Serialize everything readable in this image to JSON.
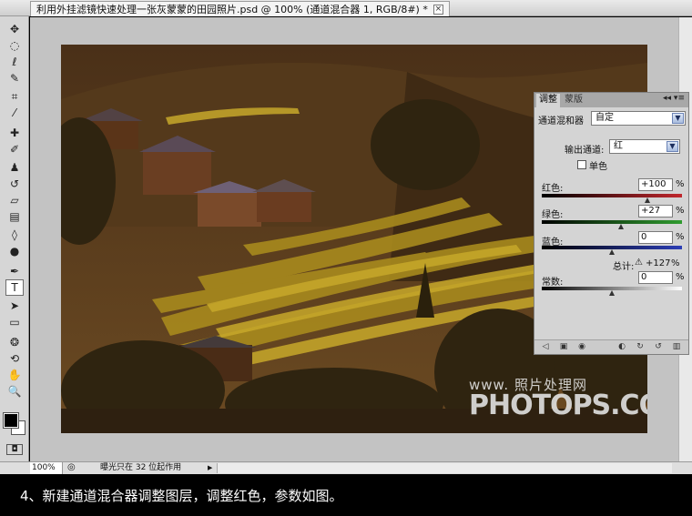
{
  "document": {
    "tab_title": "利用外挂滤镜快速处理一张灰蒙蒙的田园照片.psd @ 100% (通道混合器 1, RGB/8#) *",
    "close_glyph": "×"
  },
  "toolbox": {
    "tools": [
      {
        "name": "move-tool",
        "glyph": "✥"
      },
      {
        "name": "marquee-tool",
        "glyph": "◌"
      },
      {
        "name": "lasso-tool",
        "glyph": "ℓ"
      },
      {
        "name": "quick-select-tool",
        "glyph": "✎"
      },
      {
        "name": "crop-tool",
        "glyph": "⌗"
      },
      {
        "name": "eyedropper-tool",
        "glyph": "⁄"
      },
      {
        "name": "healing-tool",
        "glyph": "✚"
      },
      {
        "name": "brush-tool",
        "glyph": "✐"
      },
      {
        "name": "stamp-tool",
        "glyph": "♟"
      },
      {
        "name": "history-brush-tool",
        "glyph": "↺"
      },
      {
        "name": "eraser-tool",
        "glyph": "▱"
      },
      {
        "name": "gradient-tool",
        "glyph": "▤"
      },
      {
        "name": "blur-tool",
        "glyph": "◊"
      },
      {
        "name": "dodge-tool",
        "glyph": "●"
      },
      {
        "name": "pen-tool",
        "glyph": "✒"
      },
      {
        "name": "type-tool",
        "glyph": "T"
      },
      {
        "name": "path-select-tool",
        "glyph": "➤"
      },
      {
        "name": "shape-tool",
        "glyph": "▭"
      },
      {
        "name": "3d-rotate-tool",
        "glyph": "❂"
      },
      {
        "name": "3d-orbit-tool",
        "glyph": "⟲"
      },
      {
        "name": "hand-tool",
        "glyph": "✋"
      },
      {
        "name": "zoom-tool",
        "glyph": "🔍"
      }
    ]
  },
  "adjustments_panel": {
    "tab_adjust": "调整",
    "tab_mask": "蒙版",
    "menu_glyph": "◂◂ ▾≡",
    "title": "通道混和器",
    "preset_value": "自定",
    "output_channel_label": "输出通道:",
    "output_channel_value": "红",
    "monochrome_label": "单色",
    "red_label": "红色:",
    "red_value": "+100",
    "green_label": "绿色:",
    "green_value": "+27",
    "blue_label": "蓝色:",
    "blue_value": "0",
    "total_label": "总计:",
    "total_warning_glyph": "⚠",
    "total_value": "+127",
    "constant_label": "常数:",
    "constant_value": "0",
    "percent_sign": "%",
    "slider_levels": {
      "red": 100,
      "green": 27,
      "blue": 0,
      "constant": 0
    },
    "colors": {
      "red": "#c1272d",
      "green": "#2f9c2f",
      "blue": "#2c3eb5"
    }
  },
  "watermark": {
    "line1": "www.    照片处理网",
    "line2": "PHOTOPS.COM"
  },
  "statusbar": {
    "zoom": "100%",
    "info": "曝光只在 32 位起作用",
    "nav_glyph": "▶"
  },
  "caption": {
    "text": "4、新建通道混合器调整图层，调整红色，参数如图。"
  }
}
